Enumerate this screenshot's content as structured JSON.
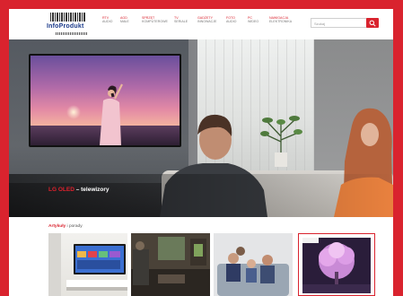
{
  "header": {
    "logo_text": "InfoProdukt",
    "nav": [
      {
        "label": "RTV",
        "sub": "Audio"
      },
      {
        "label": "AGD",
        "sub": "małe"
      },
      {
        "label": "Sprzęt",
        "sub": "komputerowe"
      },
      {
        "label": "TV",
        "sub": "Seriale"
      },
      {
        "label": "Gadżety",
        "sub": "Innowacje"
      },
      {
        "label": "Foto",
        "sub": "Audio"
      },
      {
        "label": "PC",
        "sub": "Wideo"
      },
      {
        "label": "Nawigacja",
        "sub": "Elektronika"
      }
    ],
    "search_placeholder": "Szukaj"
  },
  "hero": {
    "brand": "LG OLED",
    "caption": " – telewizory"
  },
  "articles": {
    "title_bold": "Artykuły",
    "title_rest": "i porady"
  },
  "colors": {
    "brand_red": "#d9232e",
    "logo_blue": "#1b3a8a"
  }
}
